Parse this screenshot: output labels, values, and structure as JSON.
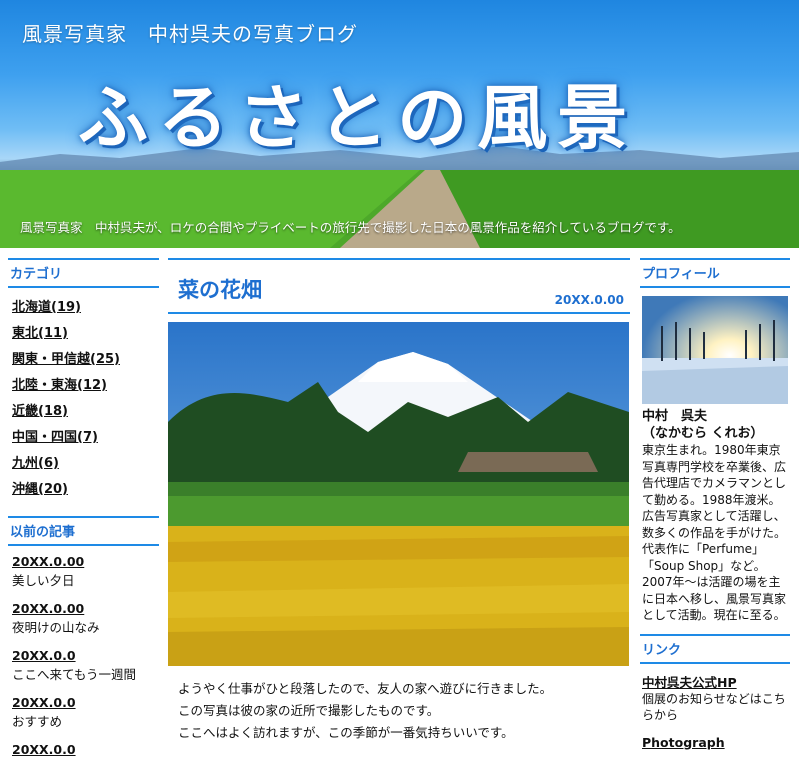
{
  "header": {
    "site_title": "風景写真家　中村呉夫の写真ブログ",
    "logo": "ふるさとの風景",
    "tagline": "風景写真家　中村呉夫が、ロケの合間やプライベートの旅行先で撮影した日本の風景作品を紹介しているブログです。"
  },
  "categories": {
    "heading": "カテゴリ",
    "items": [
      "北海道(19)",
      "東北(11)",
      "関東・甲信越(25)",
      "北陸・東海(12)",
      "近畿(18)",
      "中国・四国(7)",
      "九州(6)",
      "沖縄(20)"
    ]
  },
  "archive": {
    "heading": "以前の記事",
    "items": [
      {
        "date": "20XX.0.00",
        "title": "美しい夕日"
      },
      {
        "date": "20XX.0.00",
        "title": "夜明けの山なみ"
      },
      {
        "date": "20XX.0.0",
        "title": "ここへ来てもう一週間"
      },
      {
        "date": "20XX.0.0",
        "title": "おすすめ"
      },
      {
        "date": "20XX.0.0",
        "title": ""
      }
    ]
  },
  "post": {
    "title": "菜の花畑",
    "date": "20XX.0.00",
    "body": [
      "ようやく仕事がひと段落したので、友人の家へ遊びに行きました。",
      "この写真は彼の家の近所で撮影したものです。",
      "ここへはよく訪れますが、この季節が一番気持ちいいです。"
    ]
  },
  "profile": {
    "heading": "プロフィール",
    "name": "中村　呉夫",
    "reading": "（なかむら くれお）",
    "text": "東京生まれ。1980年東京写真専門学校を卒業後、広告代理店でカメラマンとして勤める。1988年渡米。広告写真家として活躍し、数多くの作品を手がけた。代表作に「Perfume」「Soup Shop」など。2007年～は活躍の場を主に日本へ移し、風景写真家として活動。現在に至る。"
  },
  "links": {
    "heading": "リンク",
    "items": [
      {
        "title": "中村呉夫公式HP",
        "desc": "個展のお知らせなどはこちらから"
      },
      {
        "title": "Photograph",
        "desc": ""
      }
    ]
  }
}
